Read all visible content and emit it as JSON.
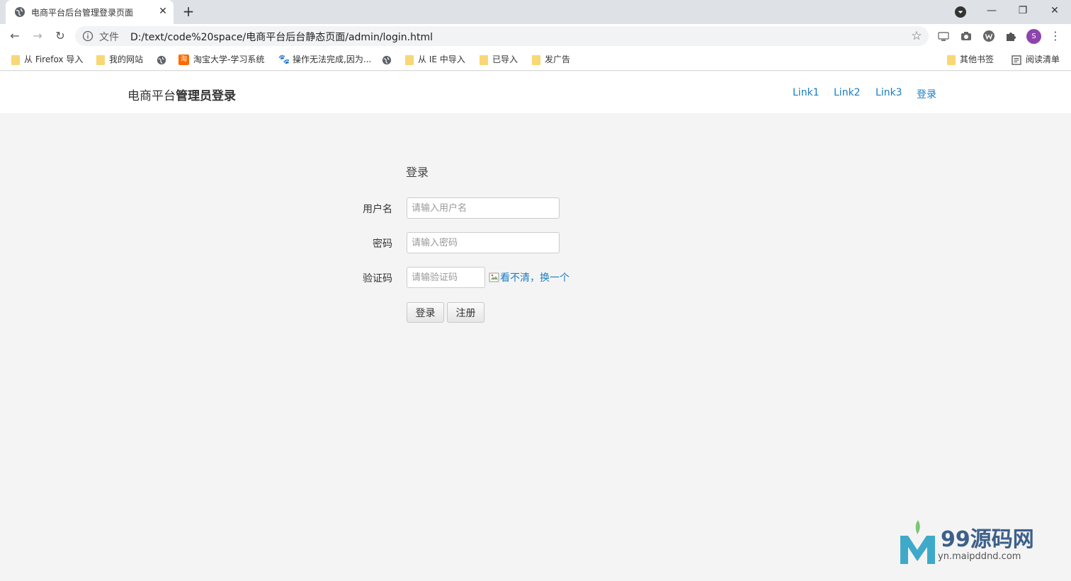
{
  "browser": {
    "tab_title": "电商平台后台管理登录页面",
    "new_tab_symbol": "+",
    "url_scheme": "文件",
    "url": "D:/text/code%20space/电商平台后台静态页面/admin/login.html",
    "profile_initial": "S"
  },
  "bookmarks": [
    {
      "label": "从 Firefox 导入",
      "icon": "folder-icon"
    },
    {
      "label": "我的网站",
      "icon": "folder-icon"
    },
    {
      "label": "",
      "icon": "globe-icon"
    },
    {
      "label": "淘宝大学-学习系统",
      "icon": "taobao-icon"
    },
    {
      "label": "操作无法完成,因为...",
      "icon": "baidu-paw-icon"
    },
    {
      "label": "",
      "icon": "globe-icon"
    },
    {
      "label": "从 IE 中导入",
      "icon": "folder-icon"
    },
    {
      "label": "已导入",
      "icon": "folder-icon"
    },
    {
      "label": "发广告",
      "icon": "folder-icon"
    },
    {
      "label": "其他书签",
      "icon": "folder-icon"
    },
    {
      "label": "阅读清单",
      "icon": "reading-list-icon"
    }
  ],
  "header": {
    "brand_prefix": "电商平台",
    "brand_bold": "管理员登录",
    "nav": [
      "Link1",
      "Link2",
      "Link3",
      "登录"
    ]
  },
  "login": {
    "heading": "登录",
    "username_label": "用户名",
    "username_placeholder": "请输入用户名",
    "password_label": "密码",
    "password_placeholder": "请输入密码",
    "captcha_label": "验证码",
    "captcha_placeholder": "请输验证码",
    "captcha_refresh": "看不清，换一个",
    "login_button": "登录",
    "register_button": "注册"
  },
  "watermark": {
    "title": "99源码网",
    "subtitle": "yn.maipddnd.com"
  },
  "colors": {
    "link": "#1a7dc4",
    "page_bg": "#f4f4f4",
    "header_bg": "#ffffff"
  }
}
